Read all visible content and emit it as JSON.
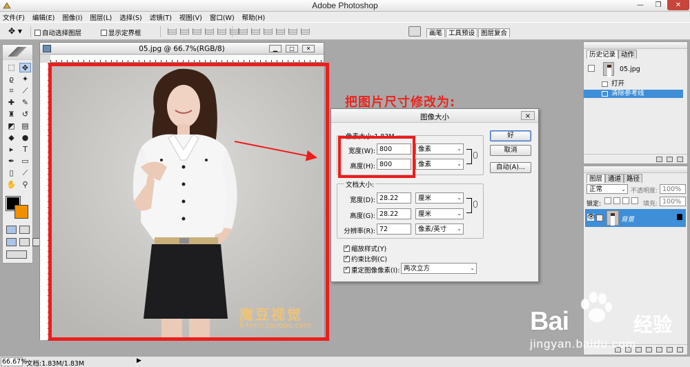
{
  "app": {
    "title": "Adobe Photoshop",
    "window_controls": {
      "minimize": "—",
      "restore": "❐",
      "close": "✕"
    }
  },
  "menu": [
    "文件(F)",
    "编辑(E)",
    "图像(I)",
    "图层(L)",
    "选择(S)",
    "滤镜(T)",
    "视图(V)",
    "窗口(W)",
    "帮助(H)"
  ],
  "options_bar": {
    "auto_select_layer": "自动选择图层",
    "show_bounding_box": "显示定界框",
    "palette_tabs": [
      "画笔",
      "工具预设",
      "图层复合"
    ]
  },
  "document": {
    "title": "05.jpg @ 66.7%(RGB/8)",
    "watermark_text": "魔豆视觉",
    "watermark_url": "64mm.taobao.com"
  },
  "annotation": "把图片尺寸修改为:",
  "dialog": {
    "title": "图像大小",
    "pixel_dimensions_label": "像素大小:1.83M",
    "width_label": "宽度(W):",
    "width_value": "800",
    "width_unit": "像素",
    "height_label": "高度(H):",
    "height_value": "800",
    "height_unit": "像素",
    "document_size_label": "文档大小:",
    "doc_width_label": "宽度(D):",
    "doc_width_value": "28.22",
    "doc_width_unit": "厘米",
    "doc_height_label": "高度(G):",
    "doc_height_value": "28.22",
    "doc_height_unit": "厘米",
    "resolution_label": "分辨率(R):",
    "resolution_value": "72",
    "resolution_unit": "像素/英寸",
    "scale_styles": "缩放样式(Y)",
    "constrain_proportions": "约束比例(C)",
    "resample_image": "重定图像像素(I):",
    "resample_method": "两次立方",
    "ok": "好",
    "cancel": "取消",
    "auto": "自动(A)...",
    "close": "×"
  },
  "history_panel": {
    "tabs": [
      "历史记录",
      "动作"
    ],
    "snapshot": "05.jpg",
    "steps": [
      "打开",
      "清除参考线"
    ],
    "selected_step": 1
  },
  "layers_panel": {
    "tabs": [
      "图层",
      "通道",
      "路径"
    ],
    "blend_mode": "正常",
    "opacity_label": "不透明度:",
    "opacity_value": "100%",
    "lock_label": "锁定:",
    "fill_label": "填充:",
    "fill_value": "100%",
    "layer_name": "背景"
  },
  "status_bar": {
    "zoom": "66.67%",
    "doc_info": "文档:1.83M/1.83M"
  },
  "baidu_watermark": {
    "brand": "Bai",
    "brand2": "经验",
    "url": "jingyan.baidu.com"
  },
  "colors": {
    "foreground": "#000000",
    "background": "#f29100",
    "annotation_red": "#ee1c1c",
    "selection_blue": "#3e8ed8"
  }
}
